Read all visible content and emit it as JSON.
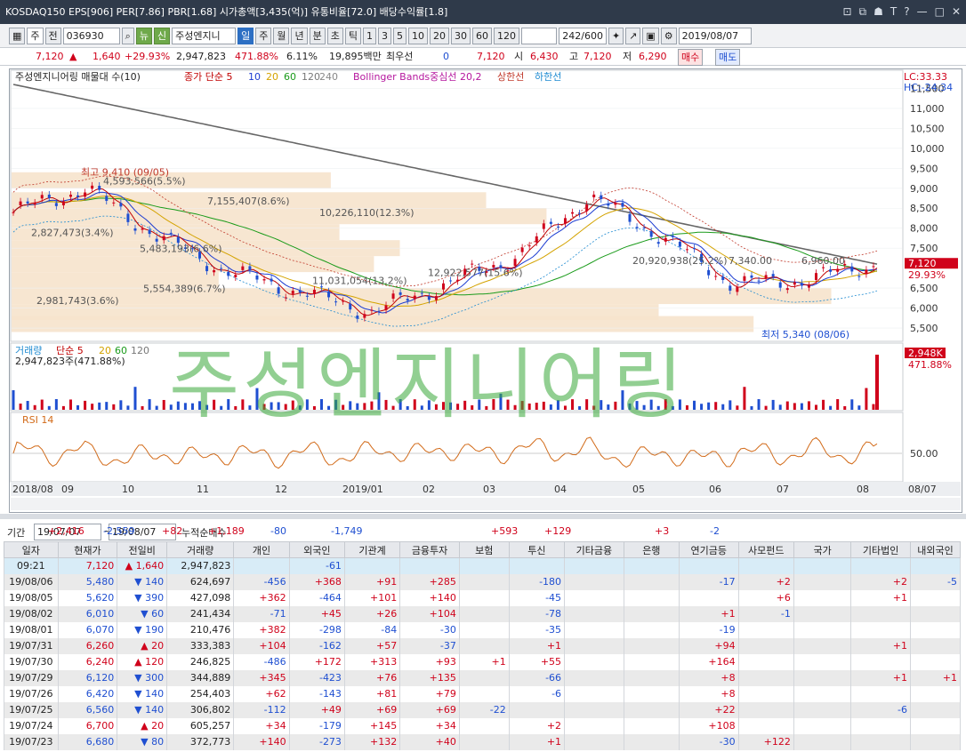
{
  "window": {
    "title": "KOSDAQ150 EPS[906] PER[7.86] PBR[1.68] 시가총액[3,435(억)] 유통비율[72.0] 배당수익률[1.8]"
  },
  "toolbar": {
    "type": "주",
    "code_label": "전",
    "code": "036930",
    "name": "주성엔지니",
    "periods": [
      "일",
      "주",
      "월",
      "년",
      "분",
      "초",
      "틱"
    ],
    "minutes": [
      "1",
      "3",
      "5",
      "10",
      "20",
      "30",
      "60",
      "120"
    ],
    "count": "242/600",
    "date": "2019/08/07",
    "new_label": "뉴",
    "shin_label": "신"
  },
  "quote": {
    "price": "7,120",
    "change": "1,640",
    "pct": "+29.93%",
    "volume": "2,947,823",
    "vol_pct": "471.88%",
    "turnover": "6.11%",
    "amount": "19,895백만",
    "pref_label": "최우선",
    "pref": "0",
    "ask": "7,120",
    "open_label": "시",
    "open": "6,430",
    "high_label": "고",
    "high": "7,120",
    "low_label": "저",
    "low": "6,290",
    "buy": "매수",
    "sell": "매도"
  },
  "chart": {
    "price_header": "주성엔지니어링 매물대 수(10)",
    "ma_header": "종가 단순 5",
    "ma_periods": [
      "10",
      "20",
      "60",
      "120",
      "240"
    ],
    "bb_header": "Bollinger Bands중심선 20,2",
    "bb_upper": "상한선",
    "bb_lower": "하한선",
    "lc": "LC:33.33",
    "hc": "HC:-24.34",
    "price_axis": [
      "11,500",
      "11,000",
      "10,500",
      "10,000",
      "9,500",
      "9,000",
      "8,500",
      "8,000",
      "7,500",
      "6,500",
      "6,000",
      "5,500"
    ],
    "last_price": "7,120",
    "last_pct": "29.93%",
    "annotations": {
      "high": "최고 9,410 (09/05)",
      "low": "최저 5,340 (08/06)"
    },
    "vol_profile": [
      "4,593,566(5.5%)",
      "7,155,407(8.6%)",
      "10,226,110(12.3%)",
      "2,827,473(3.4%)",
      "5,483,193(6.6%)",
      "5,554,389(6.7%)",
      "2,981,743(3.6%)",
      "20,920,938(25.2%)",
      "11,031,054(13.2%)",
      "12,922,577(15.6%)",
      "7,340.00",
      "6,960.00"
    ],
    "vol_header": "거래량",
    "vol_ma": "단순 5",
    "vol_ma_periods": [
      "20",
      "60",
      "120"
    ],
    "vol_info": "2,947,823주(471.88%)",
    "vol_last": "2,948K",
    "vol_last_pct": "471.88%",
    "rsi_header": "RSI 14",
    "rsi_level": "50.00",
    "dates": [
      "2018/08",
      "09",
      "10",
      "11",
      "12",
      "2019/01",
      "02",
      "03",
      "04",
      "05",
      "06",
      "07",
      "08",
      "08/07"
    ],
    "watermark": "주성엔지니어링"
  },
  "chart_data": {
    "type": "line",
    "x": [
      "2018/08",
      "09",
      "10",
      "11",
      "12",
      "2019/01",
      "02",
      "03",
      "04",
      "05",
      "06",
      "07",
      "08"
    ],
    "series": [
      {
        "name": "",
        "values": [
          8400,
          9000,
          7800,
          6900,
          6400,
          5900,
          6600,
          7300,
          8800,
          7800,
          6600,
          6700,
          7120
        ]
      }
    ],
    "ylim": [
      5300,
      11800
    ],
    "ylabel": ""
  },
  "filter": {
    "label": "기간",
    "from": "19/07/07",
    "to": "19/08/07",
    "sum_label": "누적순매수",
    "sums": [
      "+2,416",
      "-2,559",
      "+82",
      "+1,189",
      "-80",
      "-1,749",
      "",
      "",
      "+593",
      "+129",
      "",
      "+3",
      "-2"
    ]
  },
  "table": {
    "headers": [
      "일자",
      "현재가",
      "전일비",
      "거래량",
      "개인",
      "외국인",
      "기관계",
      "금융투자",
      "보험",
      "투신",
      "기타금융",
      "은행",
      "연기금등",
      "사모펀드",
      "국가",
      "기타법인",
      "내외국인"
    ],
    "rows": [
      {
        "c": [
          "09:21",
          "7,120",
          "1,640",
          "2,947,823",
          "",
          "-61",
          "",
          "",
          "",
          "",
          "",
          "",
          "",
          "",
          "",
          "",
          ""
        ],
        "up": true,
        "cur": true
      },
      {
        "c": [
          "19/08/06",
          "5,480",
          "140",
          "624,697",
          "-456",
          "+368",
          "+91",
          "+285",
          "",
          "-180",
          "",
          "",
          "-17",
          "+2",
          "",
          "+2",
          "-5"
        ],
        "up": false
      },
      {
        "c": [
          "19/08/05",
          "5,620",
          "390",
          "427,098",
          "+362",
          "-464",
          "+101",
          "+140",
          "",
          "-45",
          "",
          "",
          "",
          "+6",
          "",
          "+1",
          ""
        ],
        "up": false
      },
      {
        "c": [
          "19/08/02",
          "6,010",
          "60",
          "241,434",
          "-71",
          "+45",
          "+26",
          "+104",
          "",
          "-78",
          "",
          "",
          "+1",
          "-1",
          "",
          "",
          ""
        ],
        "up": false
      },
      {
        "c": [
          "19/08/01",
          "6,070",
          "190",
          "210,476",
          "+382",
          "-298",
          "-84",
          "-30",
          "",
          "-35",
          "",
          "",
          "-19",
          "",
          "",
          "",
          ""
        ],
        "up": false
      },
      {
        "c": [
          "19/07/31",
          "6,260",
          "20",
          "333,383",
          "+104",
          "-162",
          "+57",
          "-37",
          "",
          "+1",
          "",
          "",
          "+94",
          "",
          "",
          "+1",
          ""
        ],
        "up": true
      },
      {
        "c": [
          "19/07/30",
          "6,240",
          "120",
          "246,825",
          "-486",
          "+172",
          "+313",
          "+93",
          "+1",
          "+55",
          "",
          "",
          "+164",
          "",
          "",
          "",
          ""
        ],
        "up": true
      },
      {
        "c": [
          "19/07/29",
          "6,120",
          "300",
          "344,889",
          "+345",
          "-423",
          "+76",
          "+135",
          "",
          "-66",
          "",
          "",
          "+8",
          "",
          "",
          "+1",
          "+1"
        ],
        "up": false
      },
      {
        "c": [
          "19/07/26",
          "6,420",
          "140",
          "254,403",
          "+62",
          "-143",
          "+81",
          "+79",
          "",
          "-6",
          "",
          "",
          "+8",
          "",
          "",
          "",
          ""
        ],
        "up": false
      },
      {
        "c": [
          "19/07/25",
          "6,560",
          "140",
          "306,802",
          "-112",
          "+49",
          "+69",
          "+69",
          "-22",
          "",
          "",
          "",
          "+22",
          "",
          "",
          "-6",
          ""
        ],
        "up": false
      },
      {
        "c": [
          "19/07/24",
          "6,700",
          "20",
          "605,257",
          "+34",
          "-179",
          "+145",
          "+34",
          "",
          "+2",
          "",
          "",
          "+108",
          "",
          "",
          "",
          ""
        ],
        "up": true
      },
      {
        "c": [
          "19/07/23",
          "6,680",
          "80",
          "372,773",
          "+140",
          "-273",
          "+132",
          "+40",
          "",
          "+1",
          "",
          "",
          "-30",
          "+122",
          "",
          "",
          ""
        ],
        "up": false
      }
    ]
  },
  "colors": {
    "up": "#d0021b",
    "down": "#1f4fd1",
    "ma5": "#c00000",
    "ma10": "#1b3bd1",
    "ma20": "#d4a300",
    "ma60": "#1a9b1a",
    "ma120": "#777777",
    "bb": "#b5179e",
    "rsi": "#d26a18",
    "profile": "#f6e3cc"
  }
}
